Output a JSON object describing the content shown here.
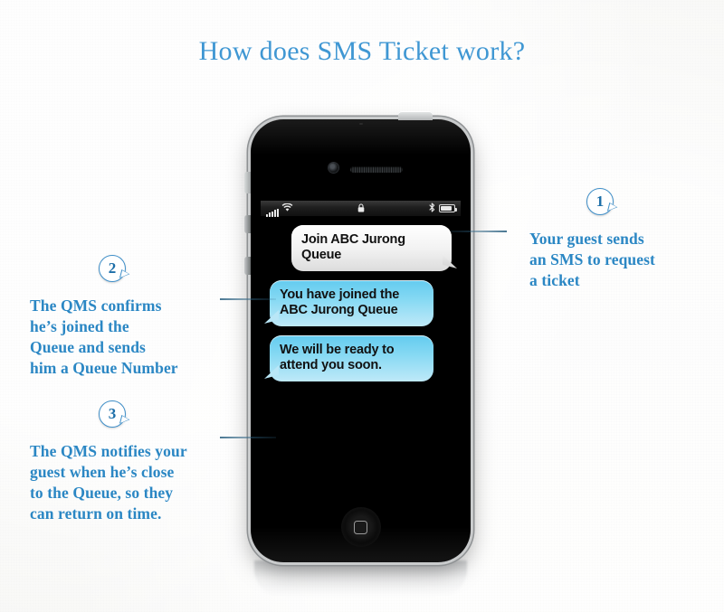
{
  "page": {
    "title": "How does SMS Ticket work?",
    "title_color": "#3f97d3",
    "body_text_color": "#2b87c4",
    "background_color": "#f7f7f5"
  },
  "steps": [
    {
      "number": "1",
      "text": "Your guest sends an SMS to request a ticket",
      "lines": [
        "Your guest sends",
        "an SMS to request",
        "a ticket"
      ],
      "side": "right"
    },
    {
      "number": "2",
      "text": "The QMS confirms he’s joined the Queue and sends him a Queue Number",
      "lines": [
        "The QMS confirms",
        "he’s joined the",
        "Queue and sends",
        "him a Queue Number"
      ],
      "side": "left"
    },
    {
      "number": "3",
      "text": "The QMS notifies your guest when he’s close to the Queue, so they can return on time.",
      "lines": [
        "The QMS notifies your",
        "guest when he’s close",
        "to the Queue, so they",
        "can return on time."
      ],
      "side": "left"
    }
  ],
  "phone": {
    "status_bar": {
      "signal_icon": "signal-bars-icon",
      "signal_bars": 5,
      "wifi_icon": "wifi-icon",
      "lock_icon": "lock-icon",
      "bluetooth_icon": "bluetooth-icon",
      "battery_icon": "battery-icon",
      "battery_level": "88"
    },
    "messages": [
      {
        "direction": "incoming",
        "text": "Join ABC Jurong Queue",
        "bubble_color": "#f2f2f2"
      },
      {
        "direction": "outgoing",
        "text": "You have joined the ABC Jurong Queue",
        "bubble_color": "#86d9f3"
      },
      {
        "direction": "outgoing",
        "text": "We will be ready to attend you soon.",
        "bubble_color": "#86d9f3"
      }
    ],
    "home_button": "home-button",
    "front_camera": "camera-icon",
    "earpiece": "speaker-grille-icon"
  }
}
